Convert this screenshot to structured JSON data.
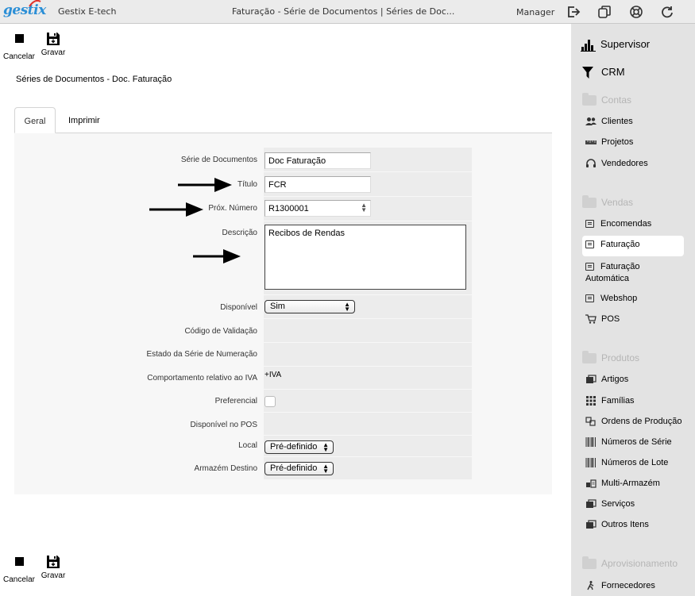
{
  "topbar": {
    "logo": "gestix",
    "app_name": "Gestix E-tech",
    "window_title": "Faturação - Série de Documentos | Séries de Doc...",
    "user": "Manager",
    "icons": [
      "logout-icon",
      "windows-icon",
      "help-lifebuoy-icon",
      "refresh-icon"
    ]
  },
  "toolbar": {
    "cancel_label": "Cancelar",
    "save_label": "Gravar"
  },
  "page": {
    "heading": "Séries de Documentos - Doc. Faturação"
  },
  "tabs": [
    {
      "label": "Geral",
      "active": true
    },
    {
      "label": "Imprimir",
      "active": false
    }
  ],
  "form": {
    "serie": {
      "label": "Série de Documentos",
      "value": "Doc Faturação"
    },
    "titulo": {
      "label": "Título",
      "value": "FCR"
    },
    "prox_numero": {
      "label": "Próx. Número",
      "value": "R1300001"
    },
    "descricao": {
      "label": "Descrição",
      "value": "Recibos de Rendas"
    },
    "disponivel": {
      "label": "Disponível",
      "value": "Sim"
    },
    "codigo_validacao": {
      "label": "Código de Validação",
      "value": ""
    },
    "estado_serie": {
      "label": "Estado da Série de Numeração",
      "value": ""
    },
    "comportamento_iva": {
      "label": "Comportamento relativo ao IVA",
      "value": "+IVA"
    },
    "preferencial": {
      "label": "Preferencial",
      "checked": false
    },
    "disponivel_pos": {
      "label": "Disponível no POS",
      "value": ""
    },
    "local": {
      "label": "Local",
      "value": "Pré-definido"
    },
    "armazem_destino": {
      "label": "Armazém Destino",
      "value": "Pré-definido"
    }
  },
  "sidebar": {
    "top_items": [
      {
        "label": "Supervisor",
        "icon": "bar-chart-icon"
      },
      {
        "label": "CRM",
        "icon": "funnel-icon"
      }
    ],
    "sections": [
      {
        "title": "Contas",
        "items": [
          {
            "label": "Clientes",
            "icon": "users-icon"
          },
          {
            "label": "Projetos",
            "icon": "ruler-icon"
          },
          {
            "label": "Vendedores",
            "icon": "headset-icon"
          }
        ]
      },
      {
        "title": "Vendas",
        "items": [
          {
            "label": "Encomendas",
            "icon": "document-icon"
          },
          {
            "label": "Faturação",
            "icon": "document-icon",
            "active": true
          },
          {
            "label": "Faturação Automática",
            "icon": "document-icon"
          },
          {
            "label": "Webshop",
            "icon": "document-icon"
          },
          {
            "label": "POS",
            "icon": "cart-icon"
          }
        ]
      },
      {
        "title": "Produtos",
        "items": [
          {
            "label": "Artigos",
            "icon": "boxes-icon"
          },
          {
            "label": "Famílias",
            "icon": "grid-icon"
          },
          {
            "label": "Ordens de Produção",
            "icon": "production-icon"
          },
          {
            "label": "Números de Série",
            "icon": "barcode-icon"
          },
          {
            "label": "Números de Lote",
            "icon": "barcode-icon"
          },
          {
            "label": "Multi-Armazém",
            "icon": "warehouse-icon"
          },
          {
            "label": "Serviços",
            "icon": "boxes-icon"
          },
          {
            "label": "Outros Itens",
            "icon": "boxes-icon"
          }
        ]
      },
      {
        "title": "Aprovisionamento",
        "items": [
          {
            "label": "Fornecedores",
            "icon": "walker-icon"
          }
        ]
      }
    ]
  }
}
